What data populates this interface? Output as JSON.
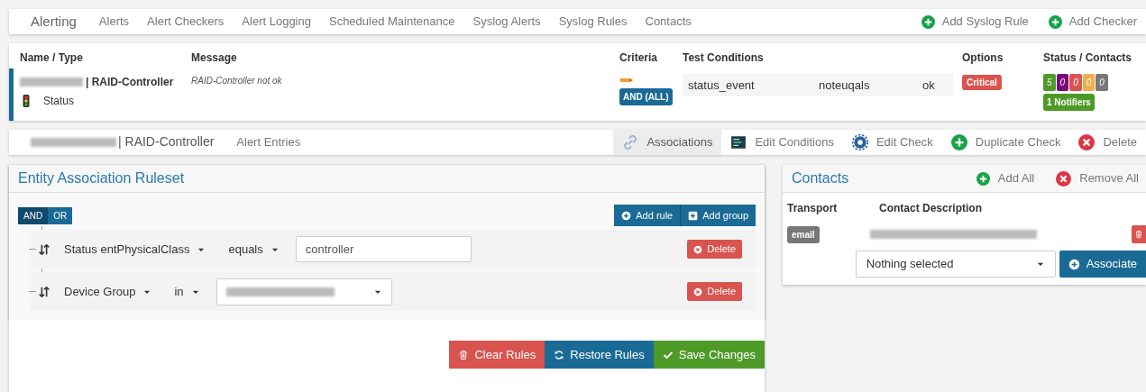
{
  "nav": {
    "title": "Alerting",
    "links": [
      {
        "label": "Alerts"
      },
      {
        "label": "Alert Checkers"
      },
      {
        "label": "Alert Logging"
      },
      {
        "label": "Scheduled Maintenance"
      },
      {
        "label": "Syslog Alerts"
      },
      {
        "label": "Syslog Rules"
      },
      {
        "label": "Contacts"
      }
    ],
    "actions": [
      {
        "label": "Add Syslog Rule"
      },
      {
        "label": "Add Checker"
      }
    ]
  },
  "alert_table": {
    "columns": [
      "Name / Type",
      "Message",
      "Criteria",
      "Test Conditions",
      "Options",
      "Status / Contacts"
    ],
    "row": {
      "name": "| RAID-Controller",
      "type": "Status",
      "message": "RAID-Controller not ok",
      "criteria": "AND (ALL)",
      "condition": [
        "status_event",
        "noteuqals",
        "ok"
      ],
      "option": "Critical",
      "counts": [
        {
          "value": "5",
          "color": "#4e9a28"
        },
        {
          "value": "0",
          "color": "#7a0a7a"
        },
        {
          "value": "0",
          "color": "#d9534f"
        },
        {
          "value": "0",
          "color": "#f0ad4e"
        },
        {
          "value": "0",
          "color": "#777777"
        }
      ],
      "notifiers": "1 Notifiers"
    }
  },
  "check_nav": {
    "title": "| RAID-Controller",
    "link": "Alert Entries",
    "tabs": [
      {
        "label": "Associations",
        "selected": true
      },
      {
        "label": "Edit Conditions",
        "selected": false
      },
      {
        "label": "Edit Check",
        "selected": false
      },
      {
        "label": "Duplicate Check",
        "selected": false
      },
      {
        "label": "Delete",
        "selected": false
      }
    ]
  },
  "ruleset": {
    "title": "Entity Association Ruleset",
    "logic": [
      {
        "label": "AND",
        "selected": true
      },
      {
        "label": "OR",
        "selected": false
      }
    ],
    "add_rule": "Add rule",
    "add_group": "Add group",
    "rules": [
      {
        "field": "Status entPhysicalClass",
        "operator": "equals",
        "kind": "text",
        "value": "controller",
        "delete": "Delete"
      },
      {
        "field": "Device Group",
        "operator": "in",
        "kind": "select",
        "delete": "Delete"
      }
    ],
    "buttons": [
      {
        "label": "Clear Rules",
        "kind": "clear"
      },
      {
        "label": "Restore Rules",
        "kind": "restore"
      },
      {
        "label": "Save Changes",
        "kind": "save"
      }
    ]
  },
  "contacts": {
    "title": "Contacts",
    "add_all": "Add All",
    "remove_all": "Remove All",
    "columns": [
      "Transport",
      "Contact Description"
    ],
    "rows": [
      {
        "transport": "email"
      }
    ],
    "select": {
      "placeholder": "Nothing selected"
    },
    "associate": "Associate"
  }
}
